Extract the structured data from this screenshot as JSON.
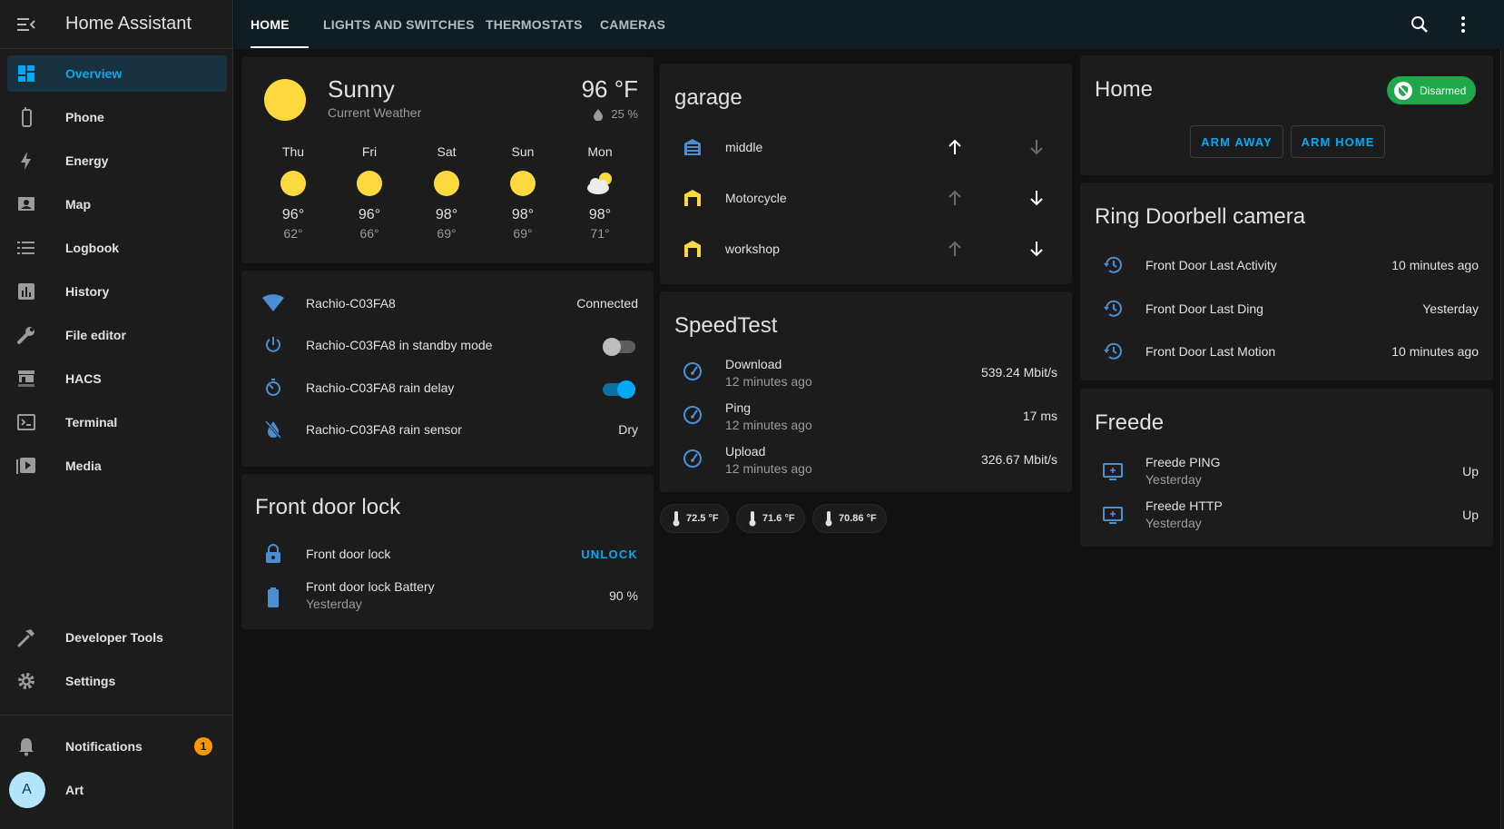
{
  "app": {
    "title": "Home Assistant"
  },
  "sidebar": {
    "items": [
      {
        "label": "Overview",
        "icon": "dashboard-icon"
      },
      {
        "label": "Phone",
        "icon": "phone-icon"
      },
      {
        "label": "Energy",
        "icon": "lightning-icon"
      },
      {
        "label": "Map",
        "icon": "map-icon"
      },
      {
        "label": "Logbook",
        "icon": "list-icon"
      },
      {
        "label": "History",
        "icon": "chart-icon"
      },
      {
        "label": "File editor",
        "icon": "wrench-icon"
      },
      {
        "label": "HACS",
        "icon": "hacs-icon"
      },
      {
        "label": "Terminal",
        "icon": "terminal-icon"
      },
      {
        "label": "Media",
        "icon": "media-icon"
      }
    ],
    "developer_tools": "Developer Tools",
    "settings": "Settings",
    "notifications": "Notifications",
    "notifications_count": "1",
    "user_initial": "A",
    "user_name": "Art"
  },
  "tabs": [
    "HOME",
    "LIGHTS AND SWITCHES",
    "THERMOSTATS",
    "CAMERAS"
  ],
  "weather": {
    "condition": "Sunny",
    "subtitle": "Current Weather",
    "temperature": "96 °F",
    "humidity": "25 %",
    "forecast": [
      {
        "day": "Thu",
        "hi": "96°",
        "lo": "62°",
        "icon": "sunny"
      },
      {
        "day": "Fri",
        "hi": "96°",
        "lo": "66°",
        "icon": "sunny"
      },
      {
        "day": "Sat",
        "hi": "98°",
        "lo": "69°",
        "icon": "sunny"
      },
      {
        "day": "Sun",
        "hi": "98°",
        "lo": "69°",
        "icon": "sunny"
      },
      {
        "day": "Mon",
        "hi": "98°",
        "lo": "71°",
        "icon": "partly-cloudy"
      }
    ]
  },
  "rachio": {
    "rows": [
      {
        "name": "Rachio-C03FA8",
        "value": "Connected"
      },
      {
        "name": "Rachio-C03FA8 in standby mode",
        "toggle": "off"
      },
      {
        "name": "Rachio-C03FA8 rain delay",
        "toggle": "on"
      },
      {
        "name": "Rachio-C03FA8 rain sensor",
        "value": "Dry"
      }
    ]
  },
  "lock": {
    "title": "Front door lock",
    "lock_name": "Front door lock",
    "unlock_label": "UNLOCK",
    "battery_name": "Front door lock Battery",
    "battery_sub": "Yesterday",
    "battery_value": "90 %"
  },
  "garage": {
    "title": "garage",
    "doors": [
      {
        "name": "middle"
      },
      {
        "name": "Motorcycle"
      },
      {
        "name": "workshop"
      }
    ]
  },
  "speedtest": {
    "title": "SpeedTest",
    "rows": [
      {
        "name": "Download",
        "sub": "12 minutes ago",
        "value": "539.24 Mbit/s"
      },
      {
        "name": "Ping",
        "sub": "12 minutes ago",
        "value": "17 ms"
      },
      {
        "name": "Upload",
        "sub": "12 minutes ago",
        "value": "326.67 Mbit/s"
      }
    ]
  },
  "chips": [
    "72.5 °F",
    "71.6 °F",
    "70.86 °F"
  ],
  "alarm": {
    "title": "Home",
    "status": "Disarmed",
    "arm_away": "ARM AWAY",
    "arm_home": "ARM HOME"
  },
  "ring": {
    "title": "Ring Doorbell camera",
    "rows": [
      {
        "name": "Front Door Last Activity",
        "value": "10 minutes ago"
      },
      {
        "name": "Front Door Last Ding",
        "value": "Yesterday"
      },
      {
        "name": "Front Door Last Motion",
        "value": "10 minutes ago"
      }
    ]
  },
  "freede": {
    "title": "Freede",
    "rows": [
      {
        "name": "Freede PING",
        "sub": "Yesterday",
        "value": "Up"
      },
      {
        "name": "Freede HTTP",
        "sub": "Yesterday",
        "value": "Up"
      }
    ]
  },
  "colors": {
    "accent": "#03a9f4",
    "sun": "#fdd93d",
    "card": "#1c1c1c",
    "background": "#111111",
    "disarmed": "#1ea84a",
    "badge": "#ff9800",
    "garage_middle_icon": "#4a8fd4",
    "garage_open_icon": "#fdd93d"
  }
}
